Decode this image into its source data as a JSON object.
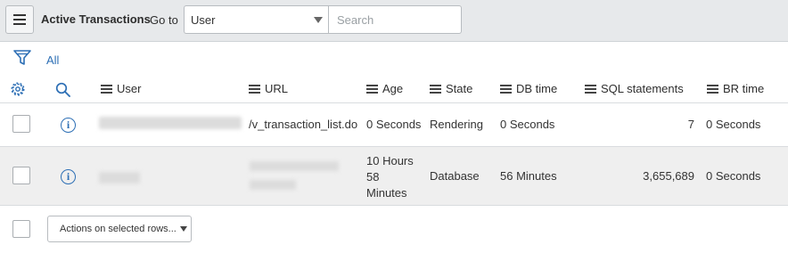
{
  "header": {
    "title": "Active Transactions",
    "goto_label": "Go to",
    "select_value": "User",
    "search_placeholder": "Search"
  },
  "filter": {
    "all_label": "All"
  },
  "columns": [
    "User",
    "URL",
    "Age",
    "State",
    "DB time",
    "SQL statements",
    "BR time"
  ],
  "rows": [
    {
      "url": "/v_transaction_list.do",
      "age": "0 Seconds",
      "state": "Rendering",
      "db_time": "0 Seconds",
      "sql_statements": "7",
      "br_time": "0 Seconds"
    },
    {
      "age": [
        "10 Hours",
        "58",
        "Minutes"
      ],
      "state": "Database",
      "db_time": "56 Minutes",
      "sql_statements": "3,655,689",
      "br_time": "0 Seconds"
    }
  ],
  "footer": {
    "actions_label": "Actions on selected rows..."
  },
  "icons": {
    "menu": "hamburger-menu-icon",
    "filter": "funnel-icon",
    "settings": "gear-icon",
    "search": "magnifier-icon",
    "info": "info-circle-icon",
    "column_menu": "lines-icon"
  },
  "colors": {
    "accent": "#2d6fb5",
    "topbar": "#e7e9eb",
    "row_alt": "#efefef"
  }
}
